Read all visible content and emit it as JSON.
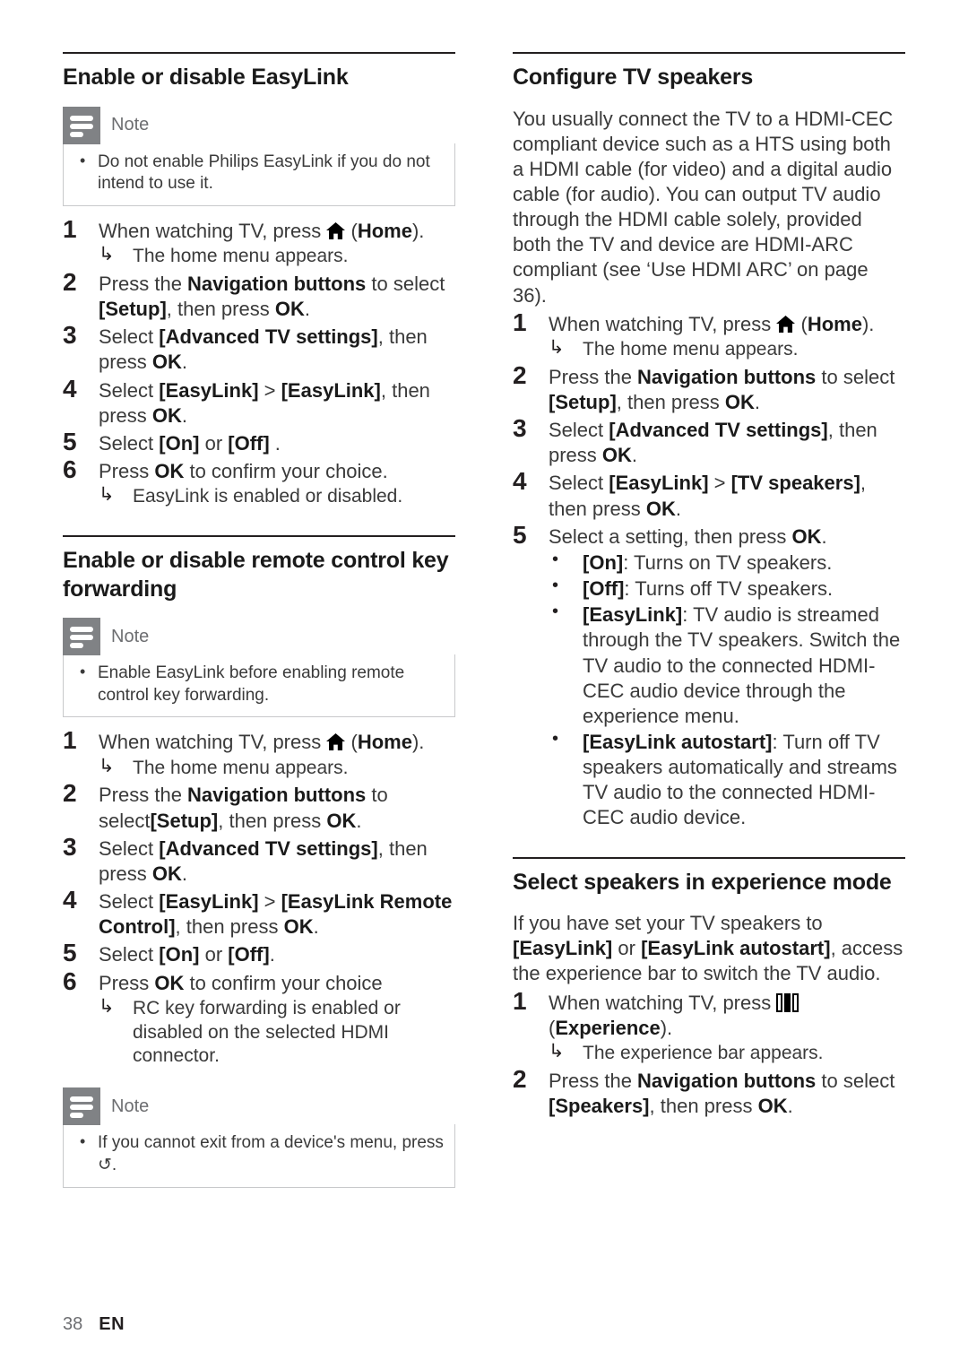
{
  "document": {
    "footer": {
      "page_number": "38",
      "language": "EN"
    },
    "note_label": "Note"
  },
  "left_column": {
    "sections": [
      {
        "heading": "Enable or disable EasyLink",
        "note": {
          "title": "Note",
          "bullets": [
            "Do not enable Philips EasyLink if you do not intend to use it."
          ]
        },
        "steps": [
          {
            "num": "1",
            "text_before_icon": "When watching TV, press ",
            "icon": "home-icon",
            "text_after_icon": " (Home).",
            "bold_after": "Home",
            "result": "The home menu appears."
          },
          {
            "num": "2",
            "text": "Press the Navigation buttons to select [Setup], then press OK."
          },
          {
            "num": "3",
            "text": "Select [Advanced TV settings], then press OK."
          },
          {
            "num": "4",
            "text": "Select [EasyLink] > [EasyLink], then press OK."
          },
          {
            "num": "5",
            "text": "Select [On] or [Off] ."
          },
          {
            "num": "6",
            "text": "Press OK to confirm your choice.",
            "result": "EasyLink is enabled or disabled."
          }
        ]
      },
      {
        "heading": "Enable or disable remote control key forwarding",
        "note": {
          "title": "Note",
          "bullets": [
            "Enable EasyLink before enabling remote control key forwarding."
          ]
        },
        "steps": [
          {
            "num": "1",
            "text_before_icon": "When watching TV, press ",
            "icon": "home-icon",
            "text_after_icon": " (Home).",
            "result": "The home menu appears."
          },
          {
            "num": "2",
            "text": "Press the Navigation buttons to select[Setup], then press OK."
          },
          {
            "num": "3",
            "text": "Select [Advanced TV settings], then press OK."
          },
          {
            "num": "4",
            "text": "Select [EasyLink] > [EasyLink Remote Control], then press OK."
          },
          {
            "num": "5",
            "text": "Select [On] or [Off]."
          },
          {
            "num": "6",
            "text": "Press OK to confirm your choice",
            "result": "RC key forwarding is enabled or disabled on the selected HDMI connector."
          }
        ],
        "trailing_note": {
          "title": "Note",
          "bullets": [
            "If you cannot exit from a device's menu, press ↺."
          ]
        }
      }
    ]
  },
  "right_column": {
    "sections": [
      {
        "heading": "Configure TV speakers",
        "paragraph": "You usually connect the TV to a HDMI-CEC compliant device such as a HTS using both a HDMI cable (for video) and a digital audio cable (for audio). You can output TV audio through the HDMI cable solely, provided both the TV and device are HDMI-ARC compliant (see ‘Use HDMI ARC’ on page 36).",
        "steps": [
          {
            "num": "1",
            "text_before_icon": "When watching TV, press ",
            "icon": "home-icon",
            "text_after_icon": " (Home).",
            "result": "The home menu appears."
          },
          {
            "num": "2",
            "text": "Press the Navigation buttons to select [Setup], then press OK."
          },
          {
            "num": "3",
            "text": "Select [Advanced TV settings], then press OK."
          },
          {
            "num": "4",
            "text": "Select [EasyLink] > [TV speakers], then press OK."
          },
          {
            "num": "5",
            "text": "Select a setting, then press OK.",
            "bullets": [
              {
                "label": "[On]",
                "rest": ": Turns on TV speakers."
              },
              {
                "label": "[Off]",
                "rest": ": Turns off TV speakers."
              },
              {
                "label": "[EasyLink]",
                "rest": ": TV audio is streamed through the TV speakers. Switch the TV audio to the connected HDMI-CEC audio device through the experience menu."
              },
              {
                "label": "[EasyLink autostart]",
                "rest": ": Turn off TV speakers automatically and streams TV audio to the connected HDMI-CEC audio device."
              }
            ]
          }
        ]
      },
      {
        "heading": "Select speakers in experience mode",
        "paragraph": "If you have set your TV speakers to [EasyLink] or [EasyLink autostart], access the experience bar to switch the TV audio.",
        "steps": [
          {
            "num": "1",
            "text_before_icon": "When watching TV, press ",
            "icon": "experience-icon",
            "text_after_icon": " (Experience).",
            "result": "The experience bar appears."
          },
          {
            "num": "2",
            "text": "Press the Navigation buttons to select [Speakers], then press OK."
          }
        ]
      }
    ]
  }
}
